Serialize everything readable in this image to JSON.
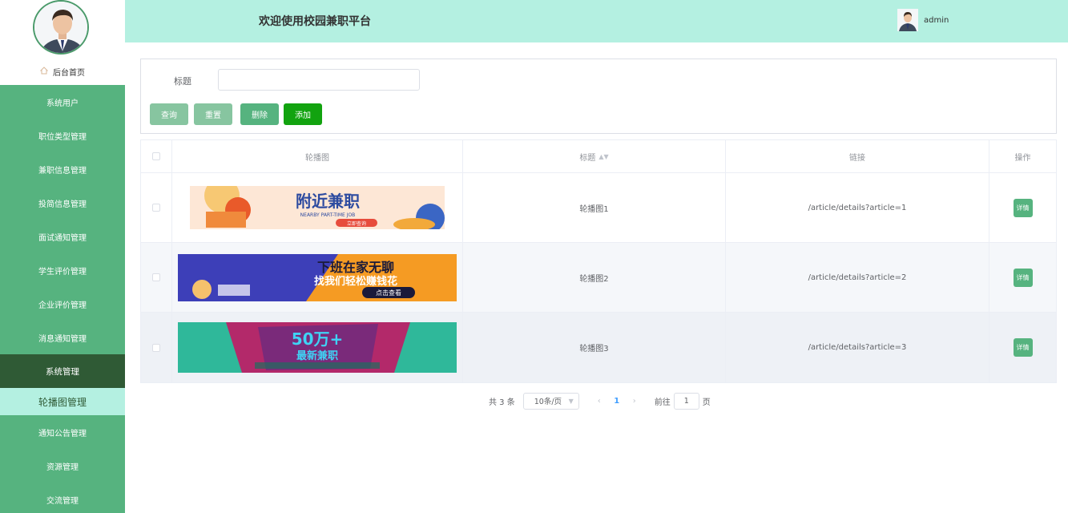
{
  "sidebar": {
    "home_label": "后台首页",
    "items": [
      {
        "label": "系统用户"
      },
      {
        "label": "职位类型管理"
      },
      {
        "label": "兼职信息管理"
      },
      {
        "label": "投简信息管理"
      },
      {
        "label": "面试通知管理"
      },
      {
        "label": "学生评价管理"
      },
      {
        "label": "企业评价管理"
      },
      {
        "label": "消息通知管理"
      },
      {
        "label": "系统管理"
      },
      {
        "label": "轮播图管理"
      },
      {
        "label": "通知公告管理"
      },
      {
        "label": "资源管理"
      },
      {
        "label": "交流管理"
      }
    ]
  },
  "header": {
    "title": "欢迎使用校园兼职平台",
    "username": "admin"
  },
  "search": {
    "title_label": "标题",
    "title_value": "",
    "query_label": "查询",
    "reset_label": "重置",
    "delete_label": "删除",
    "add_label": "添加"
  },
  "table": {
    "columns": {
      "image": "轮播图",
      "title": "标题",
      "link": "链接",
      "ops": "操作"
    },
    "rows": [
      {
        "title": "轮播图1",
        "link": "/article/details?article=1",
        "detail_label": "详情",
        "banner": {
          "main": "附近兼职",
          "sub": "NEARBY PART-TIME JOB",
          "tag": "立即查询"
        }
      },
      {
        "title": "轮播图2",
        "link": "/article/details?article=2",
        "detail_label": "详情",
        "banner": {
          "main": "下班在家无聊",
          "sub": "找我们轻松赚钱花",
          "tag": "点击查看"
        }
      },
      {
        "title": "轮播图3",
        "link": "/article/details?article=3",
        "detail_label": "详情",
        "banner": {
          "main": "50万+",
          "sub": "最新兼职",
          "tag": ""
        }
      }
    ]
  },
  "pagination": {
    "total": "共 3 条",
    "page_size": "10条/页",
    "current_page": "1",
    "goto_prefix": "前往",
    "goto_value": "1",
    "goto_suffix": "页"
  },
  "colors": {
    "sidebar": "#56b37f",
    "sidebar_dark": "#2f5a35",
    "header": "#b4f0e1",
    "add_button": "#12a30f"
  }
}
